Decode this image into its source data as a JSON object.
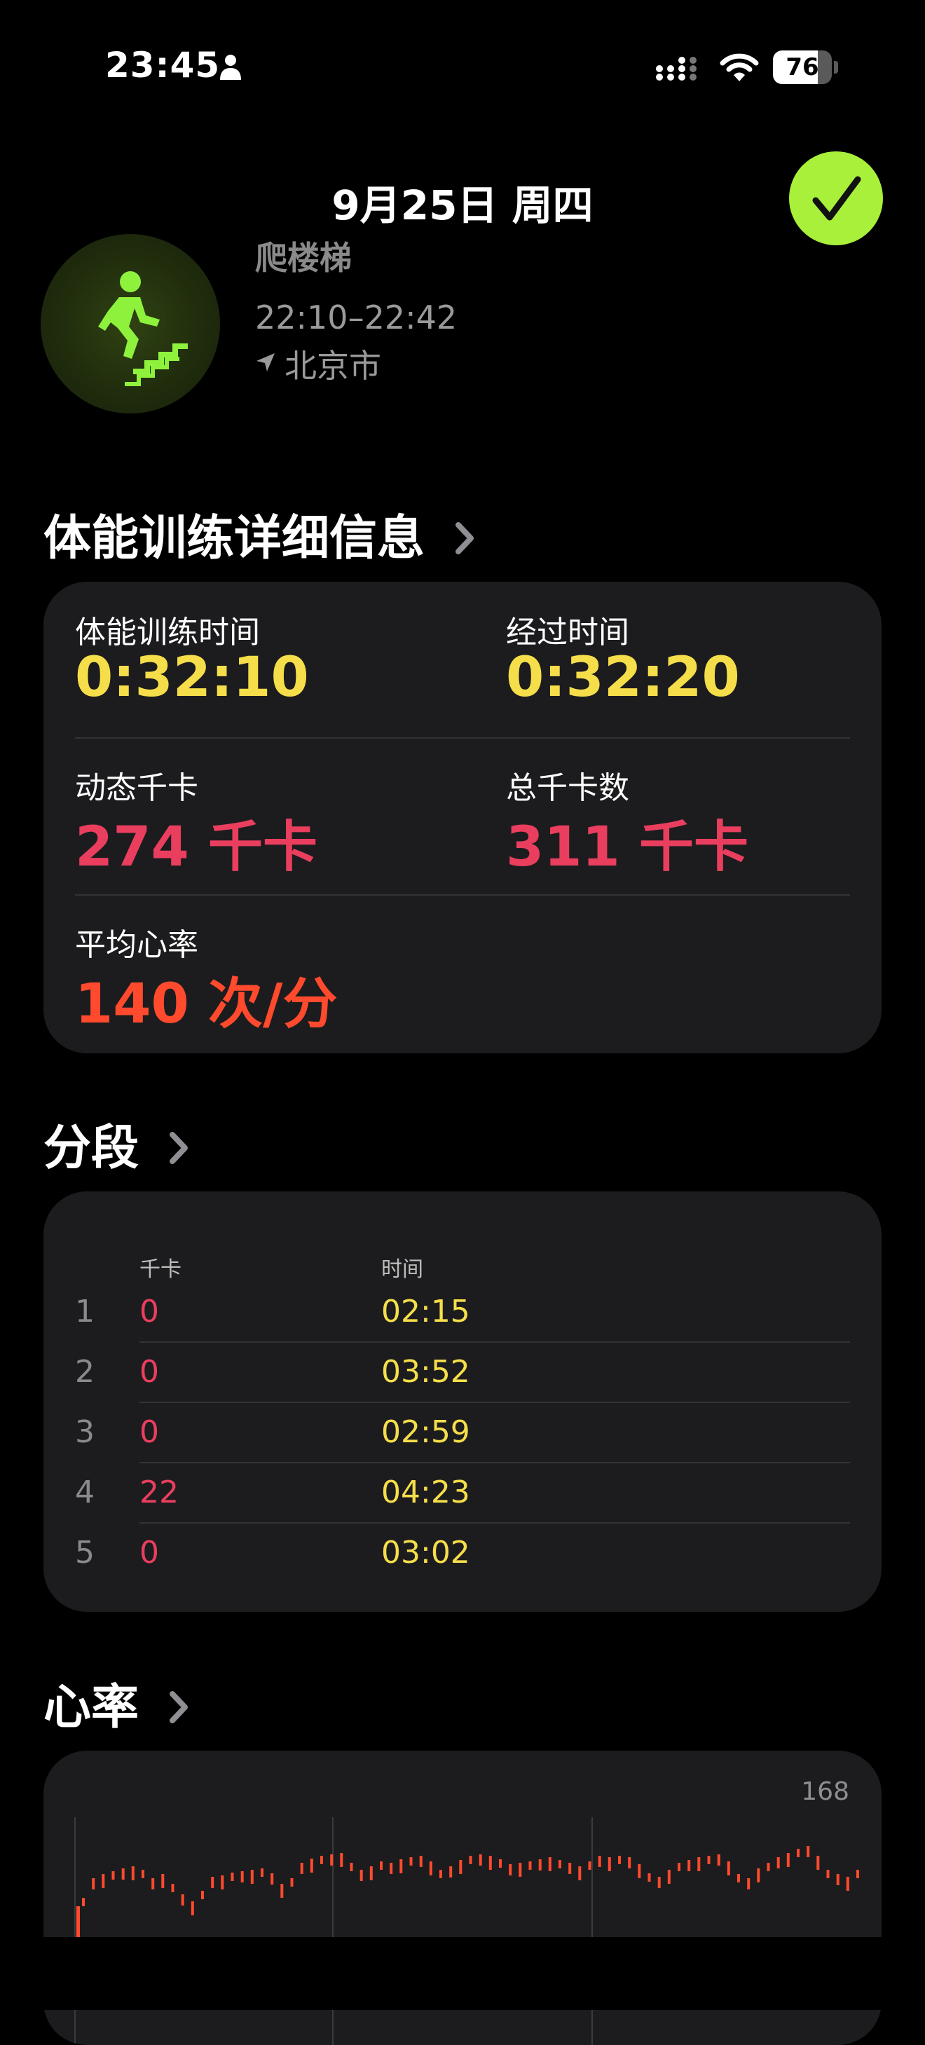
{
  "status_bar": {
    "time": "23:45",
    "battery": "76"
  },
  "header": {
    "date": "9月25日 周四",
    "workout_name": "爬楼梯",
    "time_range": "22:10–22:42",
    "location": "北京市"
  },
  "details": {
    "title": "体能训练详细信息",
    "workout_time_label": "体能训练时间",
    "workout_time": "0:32:10",
    "elapsed_label": "经过时间",
    "elapsed": "0:32:20",
    "active_cal_label": "动态千卡",
    "active_cal": "274 千卡",
    "total_cal_label": "总千卡数",
    "total_cal": "311 千卡",
    "avg_hr_label": "平均心率",
    "avg_hr": "140 次/分"
  },
  "splits": {
    "title": "分段",
    "col_cal": "千卡",
    "col_time": "时间",
    "rows": [
      {
        "n": "1",
        "cal": "0",
        "time": "02:15"
      },
      {
        "n": "2",
        "cal": "0",
        "time": "03:52"
      },
      {
        "n": "3",
        "cal": "0",
        "time": "02:59"
      },
      {
        "n": "4",
        "cal": "22",
        "time": "04:23"
      },
      {
        "n": "5",
        "cal": "0",
        "time": "03:02"
      }
    ]
  },
  "heart_rate": {
    "title": "心率",
    "max_label": "168"
  },
  "colors": {
    "yellow": "#f5de4a",
    "pink": "#ea3e5f",
    "orange": "#ff4a2d",
    "green": "#a8f03a"
  }
}
